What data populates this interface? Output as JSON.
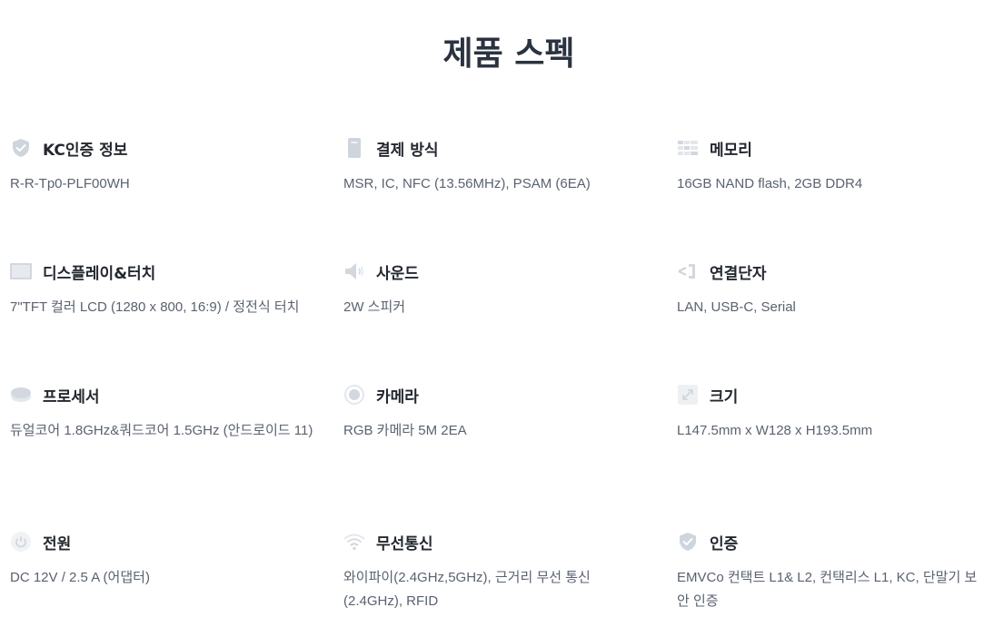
{
  "title": "제품 스펙",
  "specs": [
    {
      "icon": "shield-check-icon",
      "label": "KC인증 정보",
      "value": "R-R-Tp0-PLF00WH"
    },
    {
      "icon": "card-icon",
      "label": "결제 방식",
      "value": "MSR, IC, NFC (13.56MHz), PSAM (6EA)"
    },
    {
      "icon": "memory-grid-icon",
      "label": "메모리",
      "value": "16GB NAND flash, 2GB DDR4"
    },
    {
      "icon": "display-icon",
      "label": "디스플레이&터치",
      "value": "7\"TFT 컬러 LCD (1280 x 800, 16:9) / 정전식 터치"
    },
    {
      "icon": "speaker-icon",
      "label": "사운드",
      "value": "2W 스피커"
    },
    {
      "icon": "connector-icon",
      "label": "연결단자",
      "value": "LAN, USB-C, Serial"
    },
    {
      "icon": "processor-icon",
      "label": "프로세서",
      "value": "듀얼코어 1.8GHz&쿼드코어 1.5GHz (안드로이드 11)"
    },
    {
      "icon": "camera-icon",
      "label": "카메라",
      "value": "RGB 카메라 5M 2EA"
    },
    {
      "icon": "resize-icon",
      "label": "크기",
      "value": "L147.5mm x W128 x H193.5mm"
    },
    {
      "icon": "power-icon",
      "label": "전원",
      "value": "DC 12V / 2.5 A (어댑터)"
    },
    {
      "icon": "wifi-icon",
      "label": "무선통신",
      "value": "와이파이(2.4GHz,5GHz), 근거리 무선 통신 (2.4GHz), RFID"
    },
    {
      "icon": "shield-check-icon",
      "label": "인증",
      "value": "EMVCo 컨택트 L1& L2, 컨택리스 L1, KC, 단말기 보안 인증"
    }
  ]
}
